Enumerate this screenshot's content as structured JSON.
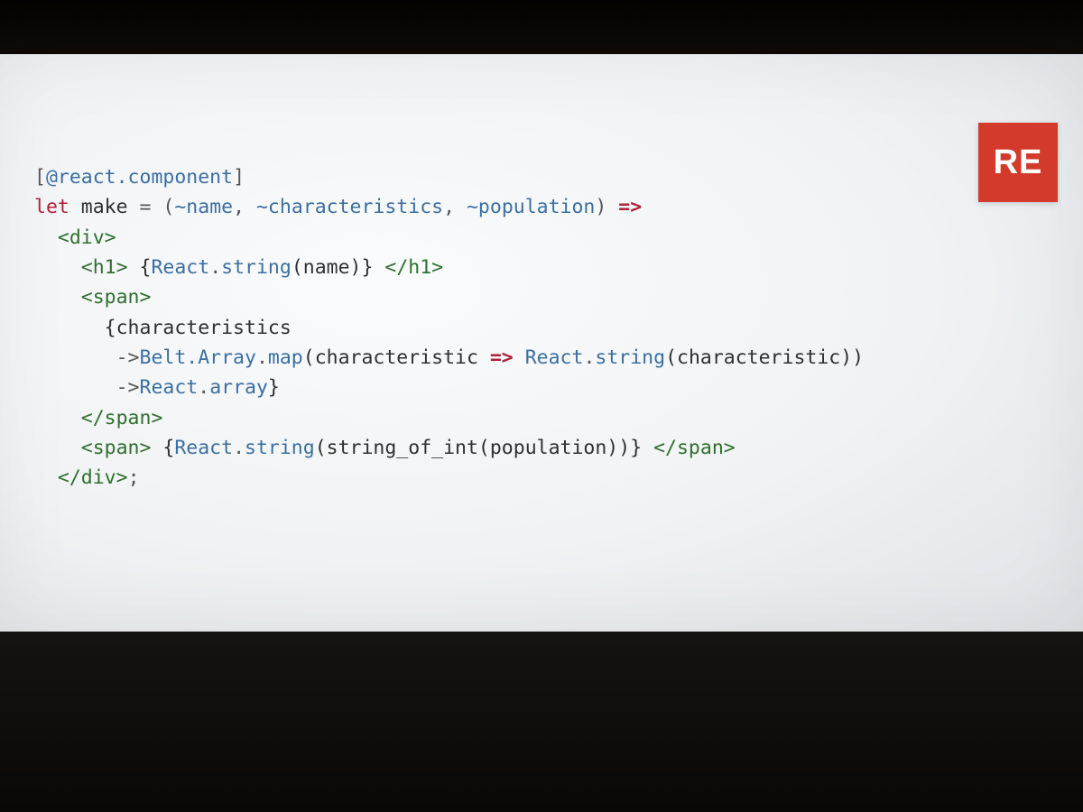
{
  "logo": {
    "text": "RE"
  },
  "code": {
    "line1": {
      "open": "[",
      "attr": "@react.component",
      "close": "]"
    },
    "line2": {
      "kw": "let",
      "name": " make ",
      "eq": "= ",
      "args_open": "(",
      "arg1": "~name",
      "sep1": ", ",
      "arg2": "~characteristics",
      "sep2": ", ",
      "arg3": "~population",
      "args_close": ") ",
      "arrow": "=>"
    },
    "line3": {
      "indent": "  ",
      "tag": "<div>"
    },
    "line4": {
      "indent": "    ",
      "tag_open": "<h1>",
      "mid1": " {",
      "ns": "React",
      "dot": ".",
      "fn": "string",
      "args": "(name)} ",
      "tag_close": "</h1>"
    },
    "line5": {
      "indent": "    ",
      "tag": "<span>"
    },
    "line6": {
      "indent": "      ",
      "text": "{characteristics"
    },
    "line7": {
      "indent": "       ",
      "arrow": "->",
      "ns": "Belt.Array",
      "dot": ".",
      "fn": "map",
      "args_a": "(characteristic ",
      "op": "=>",
      "sp": " ",
      "ns2": "React",
      "dot2": ".",
      "fn2": "string",
      "args_b": "(characteristic))"
    },
    "line8": {
      "indent": "       ",
      "arrow": "->",
      "ns": "React",
      "dot": ".",
      "fn": "array",
      "close": "}"
    },
    "line9": {
      "indent": "    ",
      "tag": "</span>"
    },
    "line10": {
      "indent": "    ",
      "tag_open": "<span>",
      "mid1": " {",
      "ns": "React",
      "dot": ".",
      "fn": "string",
      "args": "(string_of_int(population))} ",
      "tag_close": "</span>"
    },
    "line11": {
      "indent": "  ",
      "tag": "</div>",
      "semi": ";"
    }
  }
}
